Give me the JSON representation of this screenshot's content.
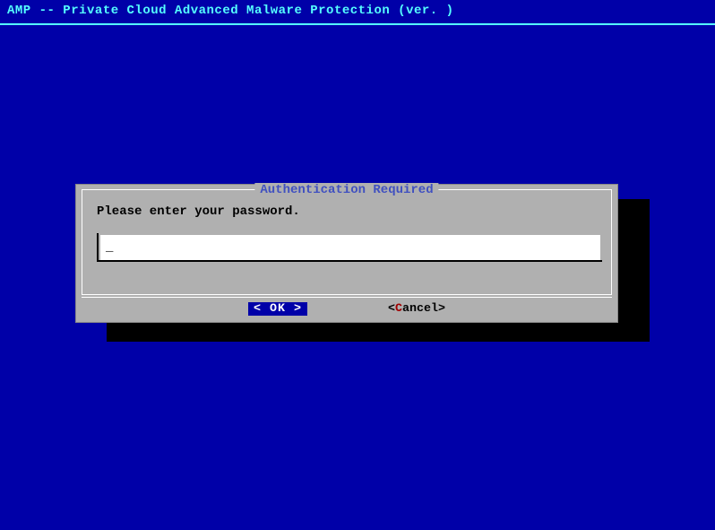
{
  "header": {
    "title": "AMP -- Private Cloud Advanced Malware Protection (ver. )"
  },
  "dialog": {
    "title": "Authentication Required",
    "prompt": "Please enter your password.",
    "password_value": "",
    "cursor": "_",
    "ok_bracket_left": "<",
    "ok_label": " OK ",
    "ok_bracket_right": ">",
    "cancel_bracket_left": "<",
    "cancel_hotkey": "C",
    "cancel_rest": "ancel",
    "cancel_bracket_right": ">"
  }
}
